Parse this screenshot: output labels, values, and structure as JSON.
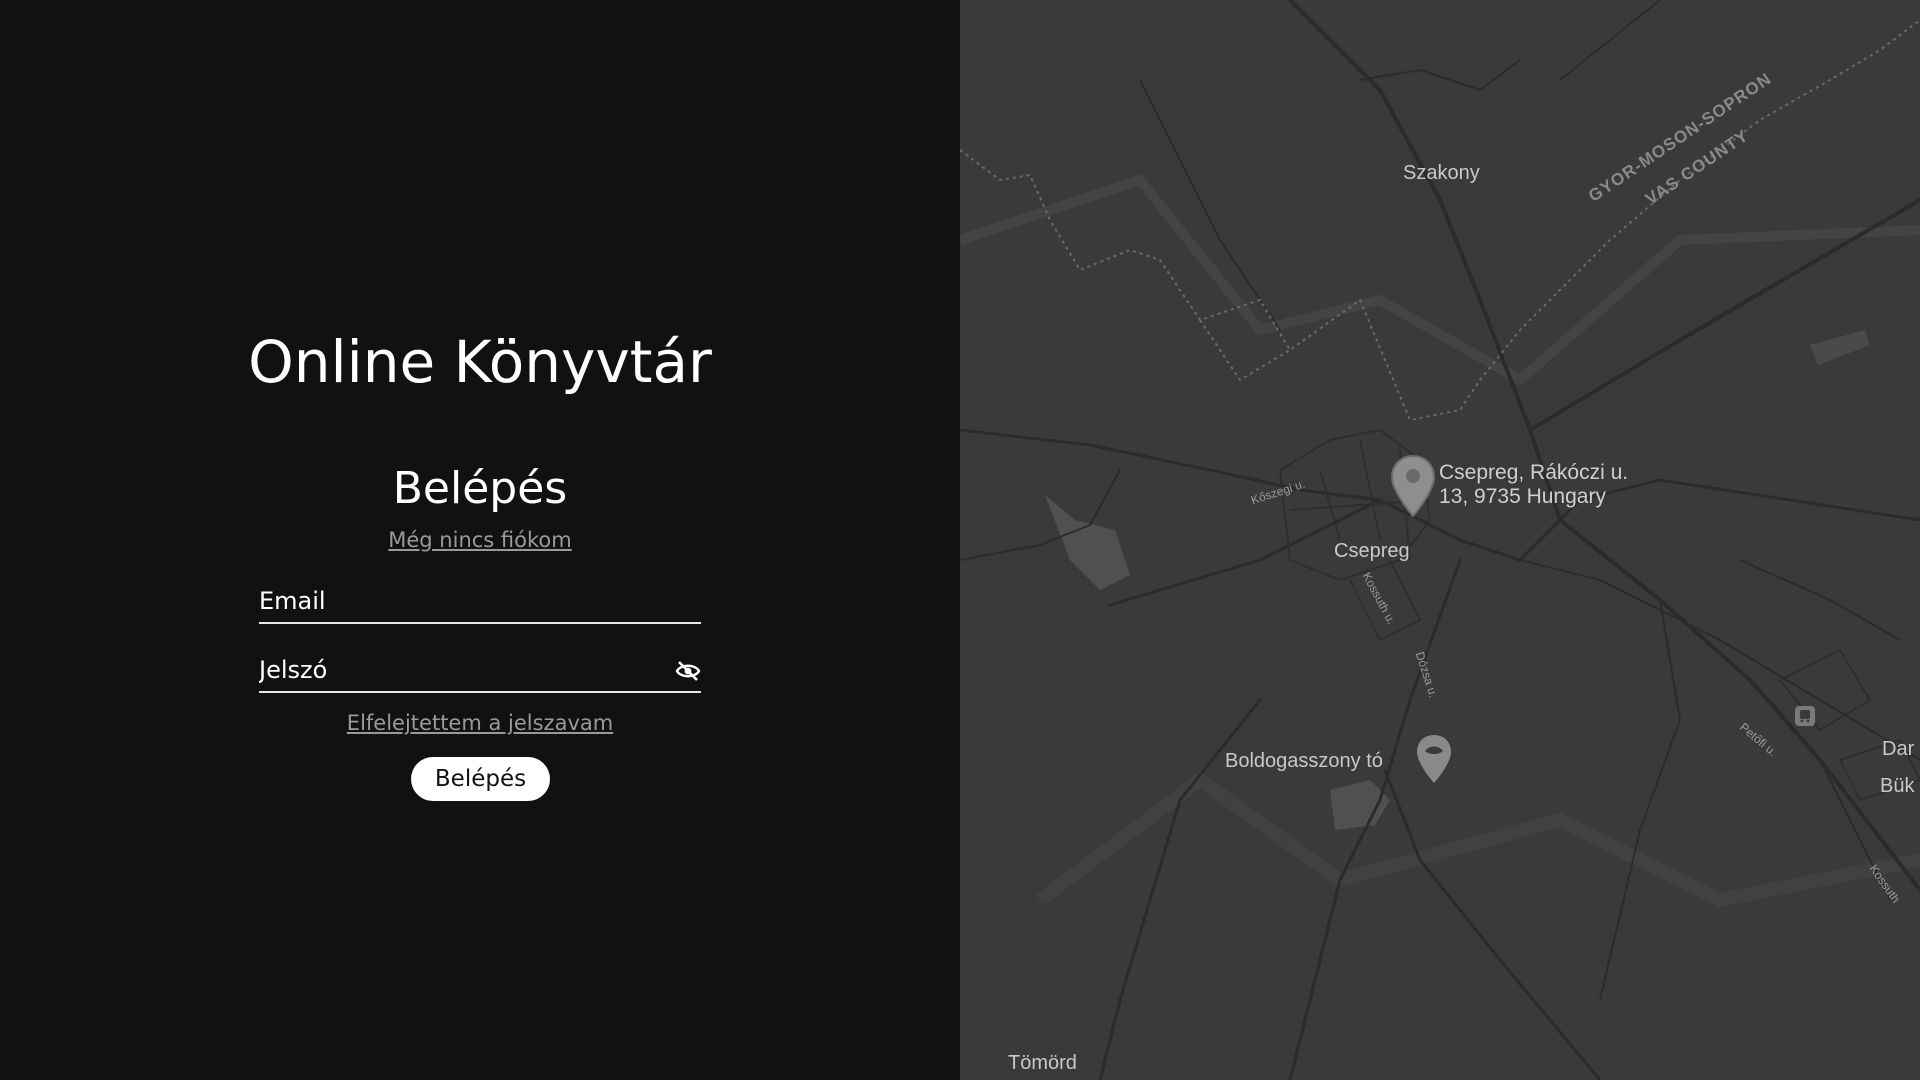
{
  "app": {
    "title": "Online Könyvtár"
  },
  "login": {
    "heading": "Belépés",
    "register_link": "Még nincs fiókom",
    "email_placeholder": "Email",
    "password_placeholder": "Jelszó",
    "toggle_visibility_icon": "eye-off-icon",
    "forgot_link": "Elfelejtettem a jelszavam",
    "submit_label": "Belépés"
  },
  "map": {
    "places": {
      "szakony": "Szakony",
      "csepreg": "Csepreg",
      "tomord": "Tömörd",
      "dar": "Dar",
      "buk": "Bük",
      "lake": "Boldogasszony tó"
    },
    "counties": {
      "north": "GYOR-MOSON-SOPRON",
      "south": "VAS COUNTY"
    },
    "streets": {
      "koszegi": "Kőszegi u.",
      "kossuth": "Kossuth u.",
      "dozsa": "Dózsa u.",
      "petofi": "Petőfi u.",
      "kossuth2": "Kossuth"
    },
    "marker": {
      "address_line1": "Csepreg, Rákóczi u.",
      "address_line2": "13, 9735 Hungary"
    },
    "colors": {
      "background": "#3a3a3a",
      "road": "#2a2a2a",
      "water": "#5a5a5a"
    }
  }
}
